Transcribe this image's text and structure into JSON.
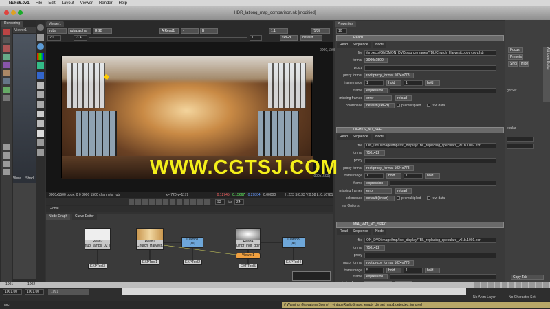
{
  "menubar": {
    "apple": "",
    "app": "Nuke6.0v1",
    "items": [
      "File",
      "Edit",
      "Layout",
      "Viewer",
      "Render",
      "Help"
    ]
  },
  "window": {
    "title": "HDR_latlong_map_comparison.nk [modified]"
  },
  "left": {
    "tab_rendering": "Rendering",
    "tab_a": "Viewer1",
    "tab_b": "View",
    "btn_a": "View",
    "btn_b": "Shad"
  },
  "viewer": {
    "tab": "Viewer1",
    "channels": "rgba",
    "alpha": "rgba.alpha",
    "color": "RGB",
    "input_a": "A  Read1",
    "blend": "-",
    "input_b": "B",
    "exposure": "-3.4",
    "gain": "20",
    "lut": "default",
    "proxy": "(1/3)",
    "zoom": "1:1",
    "frame": "1",
    "frame_range": "1",
    "aspect": "sRGB",
    "size_tl": "3000,1500",
    "size_br": "(3000x1500)",
    "status": "3000x1500 bbox: 0 0 3000 1500 channels: rgb",
    "coords": "x=  720 y=1179",
    "rgb_r": "0.12745",
    "rgb_g": "0.15667",
    "rgb_b": "0.29804",
    "rgb_a": "0.00000",
    "hsv": "H:223 S:0.33 V:0.58  L: 0.16781",
    "global": "Global",
    "fps": "fps",
    "fps_val": "24",
    "frame_cur": "93"
  },
  "watermark": "WWW.CGTSJ.COM",
  "nodegraph": {
    "tab1": "Node Graph",
    "tab2": "Curve Editor",
    "nodes": [
      {
        "name": "Read2",
        "sub": "fluo_lamps_02_nomarker"
      },
      {
        "name": "Read1",
        "sub": "Church_HarvestLobby copy.hdr"
      },
      {
        "name": "Clamp1",
        "sub": "(all)"
      },
      {
        "name": "Read4",
        "sub": "umbr_indr_dd.hdr"
      },
      {
        "name": "Clamp3",
        "sub": "(all)"
      }
    ],
    "exr": [
      "EXPTool3",
      "EXPTool1",
      "EXPTool2",
      "EXPTool5",
      "EXPTool4"
    ],
    "viewer_node": "Viewer1"
  },
  "properties": {
    "tab": "Properties",
    "count": "10",
    "panels": [
      {
        "name": "Read1",
        "tabs": [
          "Read",
          "Sequence",
          "Node"
        ],
        "file": "/projects/GNOMON_DVD/sourceimages/TBL/Church_HarvestLobby copy.hdr",
        "format": "3000x1500",
        "proxy_format": "root.proxy_format 1024x778",
        "fr_a": "1",
        "fr_hold": "hold",
        "fr_b": "1",
        "fr_hold2": "hold",
        "frame": "expression",
        "missing": "error",
        "reload": "reload",
        "colorspace": "default (sRGB)",
        "premult": "premultiplied",
        "raw": "raw data"
      },
      {
        "name": "LIGHTS_NO_SPEC",
        "tabs": [
          "Read",
          "Sequence",
          "Node"
        ],
        "file": "ON_DVD/lmage/tmp/fast_display/TBL_replacing_speculars_v01b.1002.exr",
        "format": "750x422",
        "proxy_format": "root.proxy_format 1024x778",
        "fr_a": "1",
        "fr_hold": "hold",
        "fr_b": "1",
        "fr_hold2": "hold",
        "frame": "expression",
        "missing": "error",
        "reload": "reload",
        "colorspace": "default (linear)",
        "premult": "premultiplied",
        "raw": "raw data",
        "exr": "exr Options"
      },
      {
        "name": "MIA_MAT_NO_SPEC",
        "tabs": [
          "Read",
          "Sequence",
          "Node"
        ],
        "file": "ON_DVD/lmage/tmp/fast_display/TBL_replacing_speculars_v01b.1001.exr",
        "format": "750x422",
        "proxy_format": "root.proxy_format 1024x778",
        "fr_a": "5",
        "fr_hold": "hold",
        "fr_b": "1",
        "fr_hold2": "hold",
        "frame": "expression",
        "missing": "error",
        "reload": "reload"
      }
    ],
    "labels": {
      "file": "file",
      "format": "format",
      "proxy": "proxy",
      "proxy_format": "proxy format",
      "frame_range": "frame range",
      "frame": "frame",
      "missing": "missing frames",
      "colorspace": "colorspace"
    }
  },
  "right": {
    "tab1": "Attribute Editor",
    "btn1": "Focus",
    "btn2": "Presets",
    "btn3": "Show",
    "btn4": "Hide",
    "lbl1": "ghtSet",
    "lbl2": "ecular",
    "copy": "Copy Tab"
  },
  "timeline": {
    "start": "1001.00",
    "end": "1001.00",
    "tick1": "1001",
    "tick2": "1002",
    "field": "1091",
    "nolayer": "No Anim Layer",
    "nochar": "No Character Set"
  },
  "bottom": {
    "mel": "MEL",
    "warning": "// Warning: (Mayatomr.Scene) : vintageRadioShape: empty UV set map1 detected, ignored"
  }
}
